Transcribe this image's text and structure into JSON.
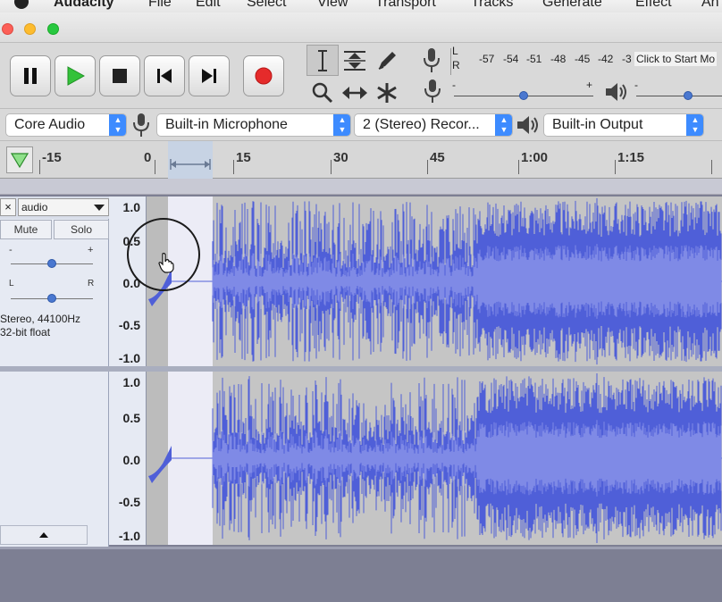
{
  "menubar": {
    "app_name": "Audacity",
    "items": [
      "File",
      "Edit",
      "Select",
      "View",
      "Transport",
      "Tracks",
      "Generate",
      "Effect",
      "An"
    ]
  },
  "transport": {
    "pause_icon": "pause-icon",
    "play_icon": "play-icon",
    "stop_icon": "stop-icon",
    "skip_start_icon": "skip-to-start-icon",
    "skip_end_icon": "skip-to-end-icon",
    "record_icon": "record-icon"
  },
  "meter": {
    "left_label": "L",
    "right_label": "R",
    "db_ticks": [
      "-57",
      "-54",
      "-51",
      "-48",
      "-45",
      "-42",
      "-3"
    ],
    "click_to_start": "Click to Start Mo",
    "slider_minus": "-",
    "slider_plus": "+",
    "record_volume": 0.5,
    "playback_volume": 0.6
  },
  "devices": {
    "host": "Core Audio",
    "input": "Built-in Microphone",
    "channels": "2 (Stereo) Recor...",
    "output": "Built-in Output"
  },
  "ruler": {
    "labels": [
      "-15",
      "0",
      "15",
      "30",
      "45",
      "1:00",
      "1:15"
    ]
  },
  "track": {
    "name": "audio",
    "close": "×",
    "mute": "Mute",
    "solo": "Solo",
    "gain_minus": "-",
    "gain_plus": "+",
    "pan_left": "L",
    "pan_right": "R",
    "gain": 0.5,
    "pan": 0.5,
    "info_line1": "Stereo, 44100Hz",
    "info_line2": "32-bit float",
    "scale_labels": [
      "1.0",
      "0.5",
      "0.0",
      "-0.5",
      "-1.0"
    ]
  },
  "colors": {
    "waveform": "#4f5fd8",
    "waveform_rms": "#7f8ae6",
    "record_red": "#e52b2b",
    "play_green": "#2fbf35",
    "select_blue": "#3d8bff"
  }
}
